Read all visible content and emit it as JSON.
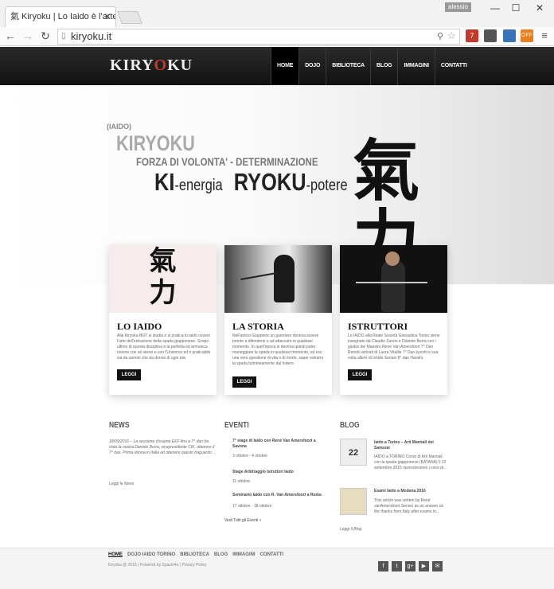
{
  "browser": {
    "tab_title": "Kiryoku | Lo Iaido è l'arte d",
    "tab_favicon": "氣",
    "close_glyph": "✕",
    "user": "alessio",
    "win_min": "—",
    "win_max": "☐",
    "win_close": "✕",
    "back": "←",
    "forward": "→",
    "reload": "↻",
    "url": "kiryoku.it",
    "page_icon": "▯",
    "zoom_icon": "⚲",
    "star_icon": "☆",
    "ext_badge": "7",
    "ext_off": "OFF",
    "menu_icon": "≡"
  },
  "site": {
    "logo_a": "KIRY",
    "logo_o": "O",
    "logo_b": "KU",
    "nav": [
      "HOME",
      "DOJO",
      "BIBLIOTECA",
      "BLOG",
      "IMMAGINI",
      "CONTATTI"
    ]
  },
  "hero": {
    "tag": "(IAIDO)",
    "title": "KIRYOKU",
    "subtitle": "FORZA DI VOLONTA' - DETERMINAZIONE",
    "ki": "KI",
    "ki_suffix": "-energia",
    "ryoku": "RYOKU",
    "ryoku_suffix": "-potere",
    "calligraphy": [
      "氣",
      "力"
    ]
  },
  "cards": [
    {
      "title": "LO IAIDO",
      "text": "Alla Kiryoku-BGT si studia e si pratica lo iaido ovvero l'arte dell'estrazione della spada giapponese. Scopo ultimo di questa disciplina è la perfetta ed armonica unione con sé stessi e con l'Universo ed è praticabile sia da uomini che da donne di ogni età.",
      "button": "LEGGI"
    },
    {
      "title": "LA STORIA",
      "text": "Nell'antico Giappone un guerriero doveva essere pronto a difendersi o ad attaccare in qualsiasi momento. In quell'epoca si doveva quindi poter maneggiare la spada in qualsiasi momento, ed era una vera questione di vita o di morte, saper estrarre la spada fulmineamente dal fodero.",
      "button": "LEGGI"
    },
    {
      "title": "ISTRUTTORI",
      "text": "Lo IAIDO alla Reale Società Ginnastica Torino viene insegnato da Claudio Zanon e Daniele Borra con i giudizi dei Maestro René Van Amersfoort 7° Dan Renshi arrivati di Laura Vitalile 7° Dan kyoshi e sua volta allievi di Ishido Sensei 8° dan Hanshi.",
      "button": "LEGGI"
    }
  ],
  "news": {
    "heading": "NEWS",
    "text": "18/09/2016 – La sessione d'esame EKF fino a 7° dan ha visto la nostra Daniele Borra, vicepresidente CIK, ottenere il 7° dan. Prima donna in Italia ad ottenere questo traguardo…",
    "more": "Leggi le News"
  },
  "events": {
    "heading": "EVENTI",
    "items": [
      {
        "title": "7° stage di Iaido con René Van Amersfoort a Savona",
        "date": "3 ottobre - 4 ottobre"
      },
      {
        "title": "Stage Arbitraggio Istruttori Iaido",
        "date": "11 ottobre"
      },
      {
        "title": "Seminario Iaido con R. Van Amersfoort a Roma",
        "date": "17 ottobre - 18 ottobre"
      }
    ],
    "more": "Vedi Tutti gli Eventi »"
  },
  "blog": {
    "heading": "BLOG",
    "items": [
      {
        "title": "Iaido a Torino – Arti Marziali dei Samurai",
        "text": "IAIDO a TORINO Corso di Arti Marziali con la spada giapponese (KATANA) Il 22 settembre 2015 riprenderanno i corsi di…",
        "thumb": "22"
      },
      {
        "title": "Esami Iaido a Modena 2016",
        "text": "This article was written by René vanAmersfoort Sensei as an answer on the thanks from Italy after exams in…",
        "thumb": ""
      }
    ],
    "more": "Leggi il Blog"
  },
  "footer": {
    "nav": [
      "HOME",
      "DOJO IAIDO TORINO",
      "BIBLIOTECA",
      "BLOG",
      "IMMAGINI",
      "CONTATTI"
    ],
    "copy": "Kiryoku @ 2015 | Powered by Spazio4u | Privacy Policy",
    "social": [
      "f",
      "t",
      "g+",
      "▶",
      "✉"
    ]
  }
}
